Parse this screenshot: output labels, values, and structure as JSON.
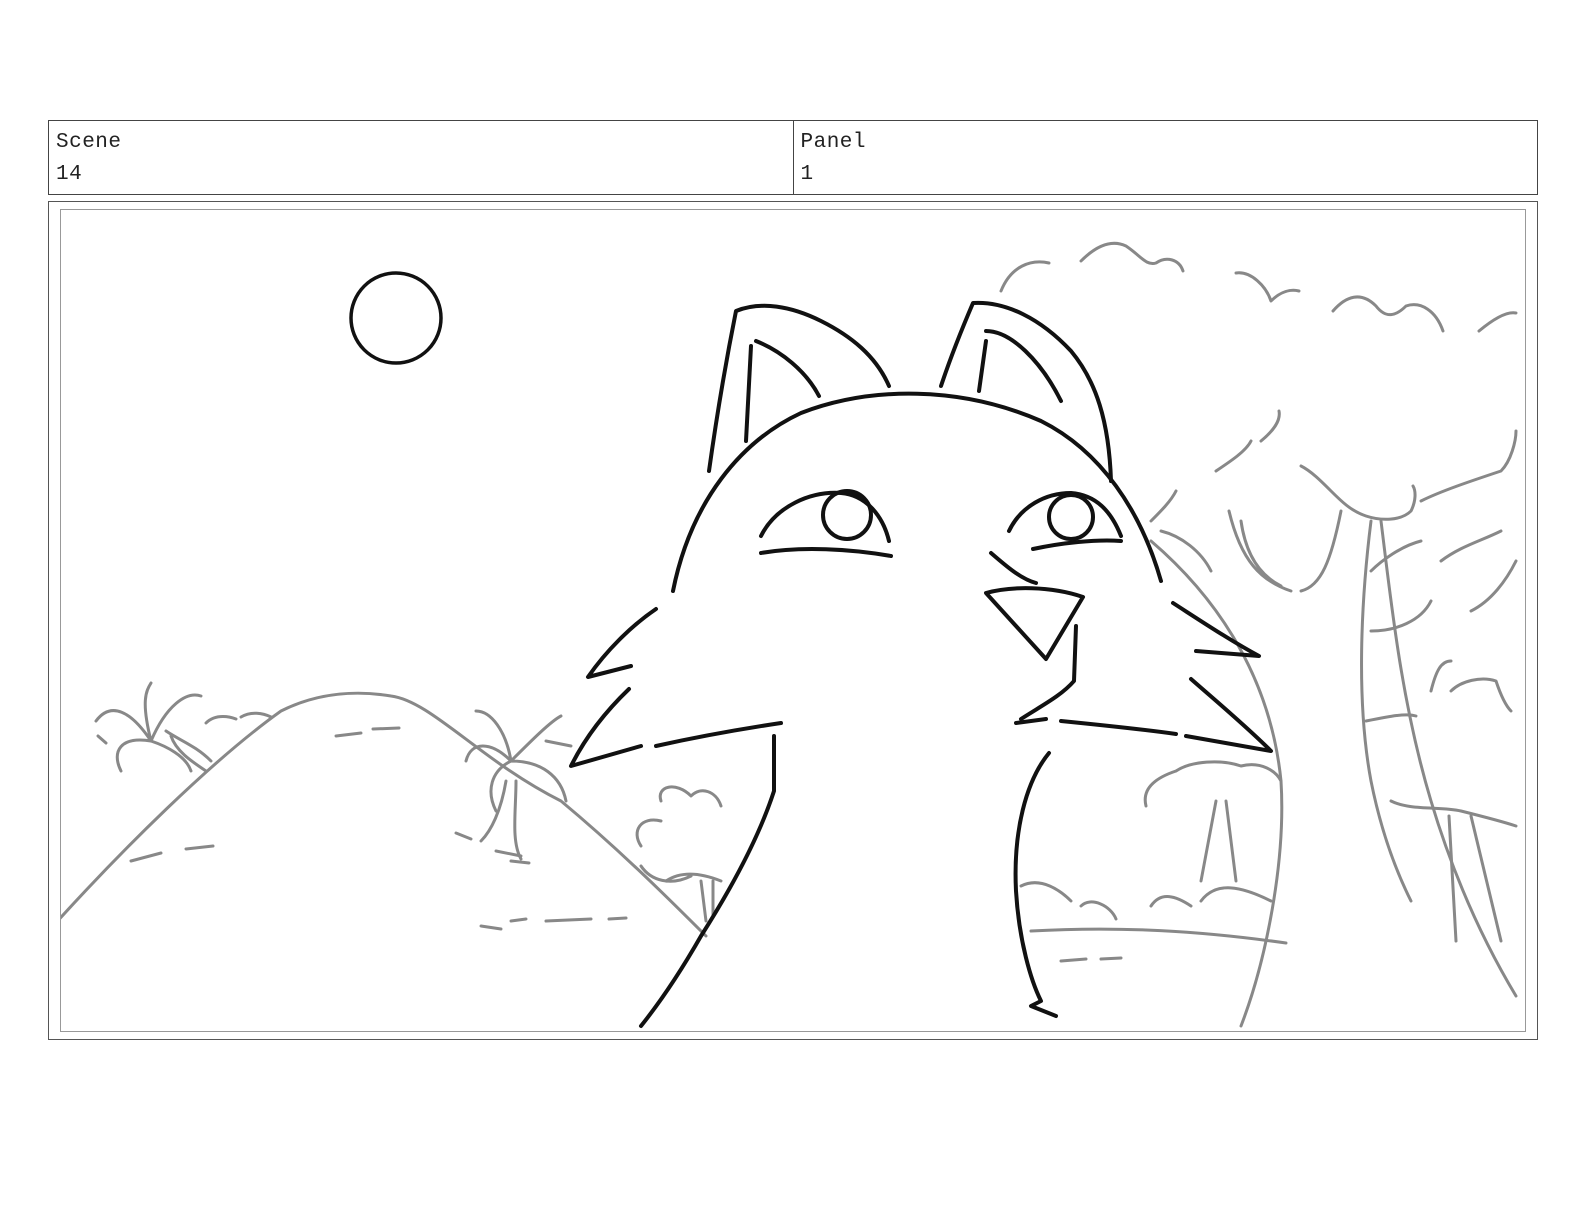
{
  "header": {
    "scene_label": "Scene",
    "scene_value": "14",
    "panel_label": "Panel",
    "panel_value": "1"
  },
  "drawing": {
    "subject": "cat-face-sketch",
    "line_color": "#111111",
    "background_line_color": "#888888"
  }
}
